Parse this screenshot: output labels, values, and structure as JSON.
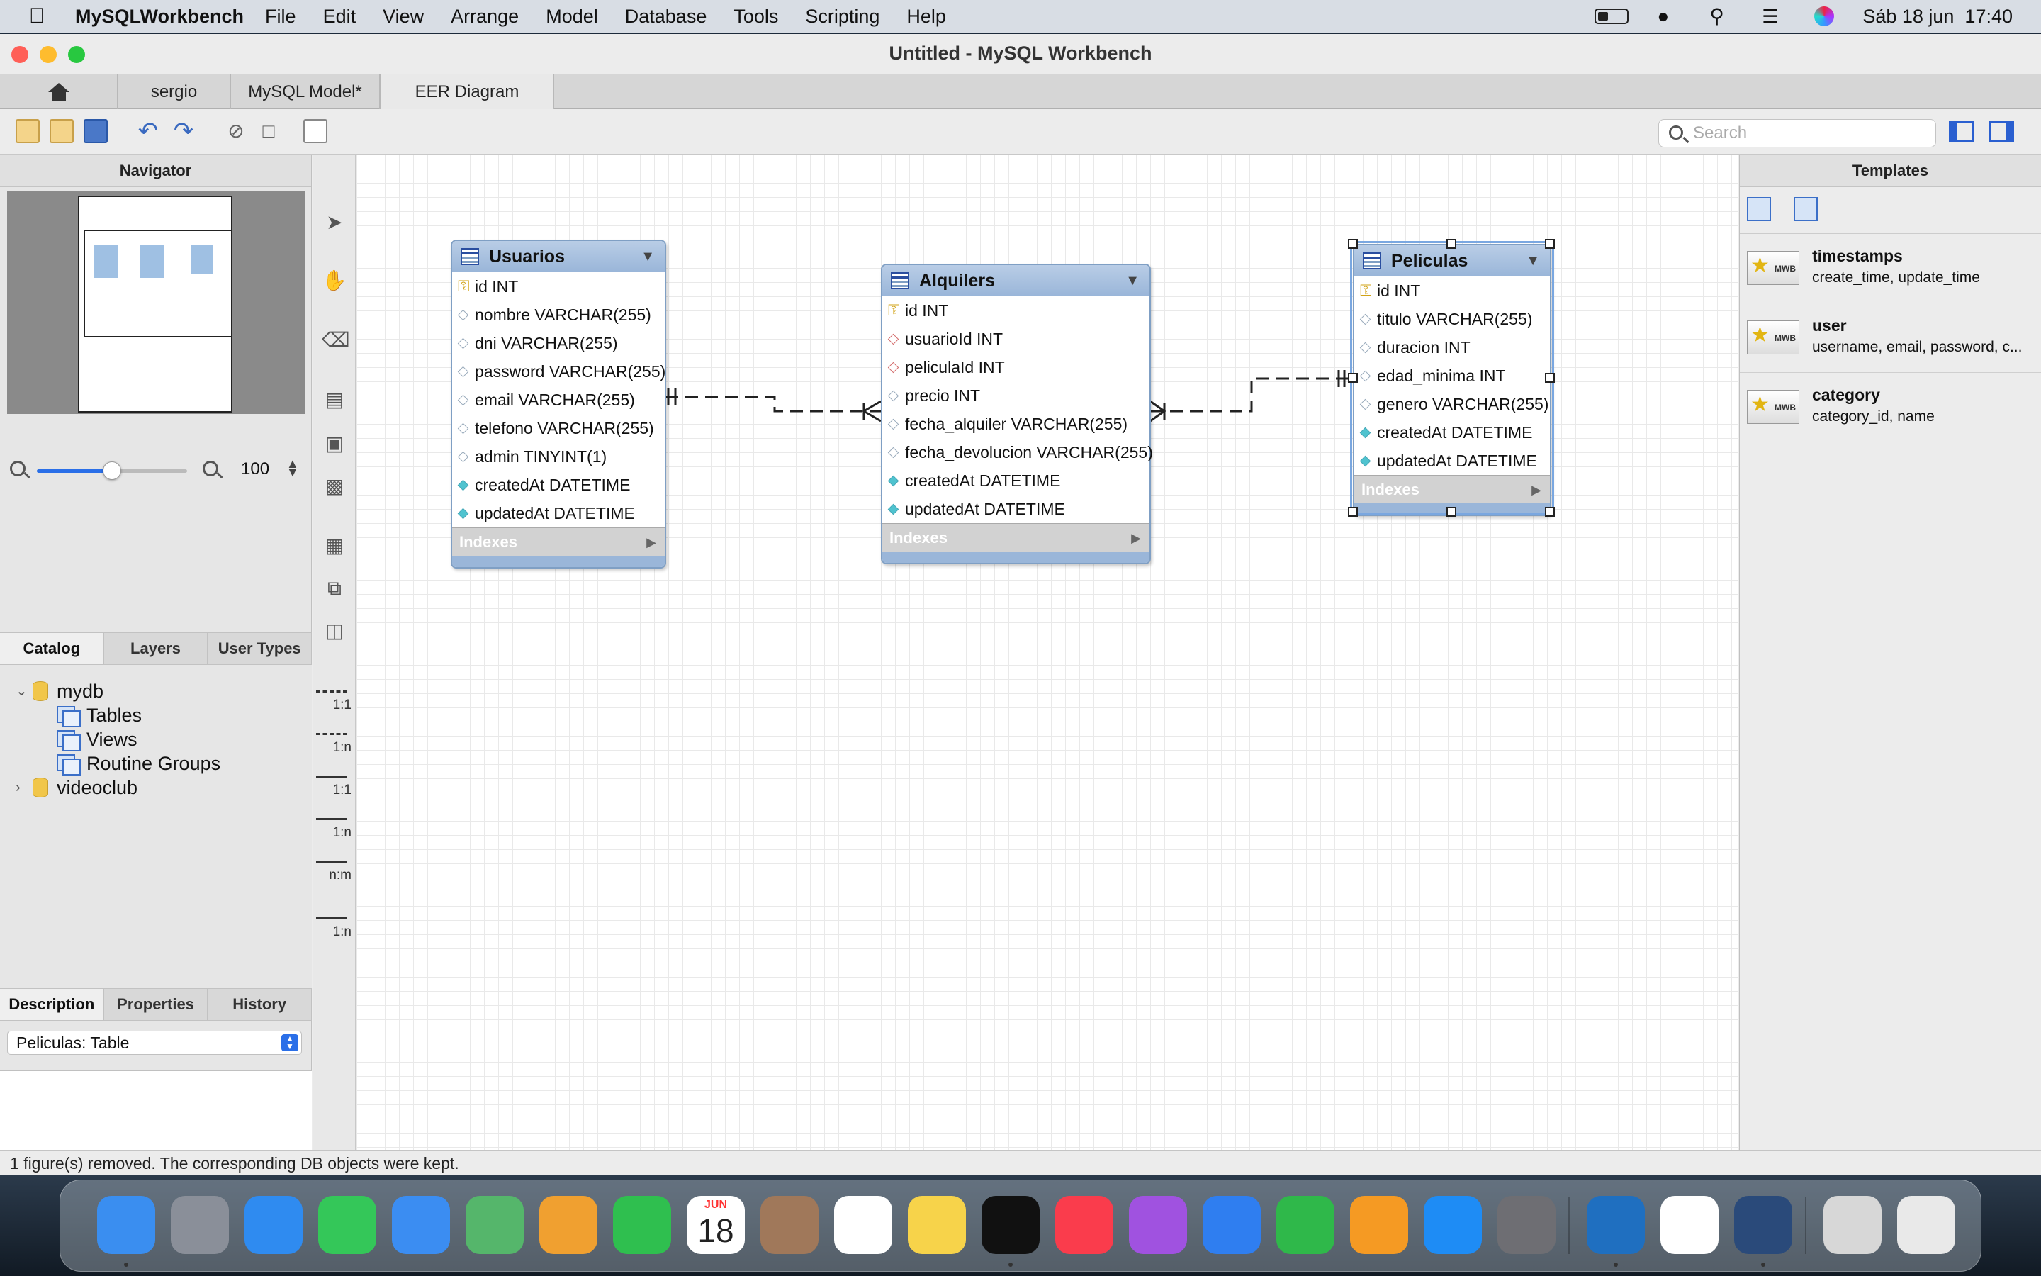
{
  "menubar": {
    "app_name": "MySQLWorkbench",
    "items": [
      "File",
      "Edit",
      "View",
      "Arrange",
      "Model",
      "Database",
      "Tools",
      "Scripting",
      "Help"
    ],
    "clock": "Sáb 18 jun  17:40"
  },
  "window": {
    "title": "Untitled - MySQL Workbench"
  },
  "tabs": [
    "sergio",
    "MySQL Model*",
    "EER Diagram"
  ],
  "toolbar": {
    "search_placeholder": "Search"
  },
  "navigator": {
    "title": "Navigator",
    "zoom_value": "100",
    "zoom_fraction": 0.5
  },
  "catalog": {
    "tabs": [
      "Catalog",
      "Layers",
      "User Types"
    ],
    "tree": [
      {
        "label": "mydb",
        "expanded": true
      },
      {
        "label": "Tables"
      },
      {
        "label": "Views"
      },
      {
        "label": "Routine Groups"
      },
      {
        "label": "videoclub",
        "expanded": false
      }
    ]
  },
  "description": {
    "tabs": [
      "Description",
      "Properties",
      "History"
    ],
    "selected": "Peliculas: Table"
  },
  "tools": {
    "relationships": [
      "1:1",
      "1:n",
      "1:1",
      "1:n",
      "n:m",
      "1:n"
    ]
  },
  "entities": [
    {
      "name": "Usuarios",
      "columns": [
        {
          "text": "id INT",
          "kind": "key"
        },
        {
          "text": "nombre VARCHAR(255)",
          "kind": "pl"
        },
        {
          "text": "dni VARCHAR(255)",
          "kind": "pl"
        },
        {
          "text": "password VARCHAR(255)",
          "kind": "pl"
        },
        {
          "text": "email VARCHAR(255)",
          "kind": "pl"
        },
        {
          "text": "telefono VARCHAR(255)",
          "kind": "pl"
        },
        {
          "text": "admin TINYINT(1)",
          "kind": "pl"
        },
        {
          "text": "createdAt DATETIME",
          "kind": "nn"
        },
        {
          "text": "updatedAt DATETIME",
          "kind": "nn"
        }
      ],
      "indexes_label": "Indexes"
    },
    {
      "name": "Alquilers",
      "columns": [
        {
          "text": "id INT",
          "kind": "key"
        },
        {
          "text": "usuarioId INT",
          "kind": "fk"
        },
        {
          "text": "peliculaId INT",
          "kind": "fk"
        },
        {
          "text": "precio INT",
          "kind": "pl"
        },
        {
          "text": "fecha_alquiler VARCHAR(255)",
          "kind": "pl"
        },
        {
          "text": "fecha_devolucion VARCHAR(255)",
          "kind": "pl"
        },
        {
          "text": "createdAt DATETIME",
          "kind": "nn"
        },
        {
          "text": "updatedAt DATETIME",
          "kind": "nn"
        }
      ],
      "indexes_label": "Indexes"
    },
    {
      "name": "Peliculas",
      "columns": [
        {
          "text": "id INT",
          "kind": "key"
        },
        {
          "text": "titulo VARCHAR(255)",
          "kind": "pl"
        },
        {
          "text": "duracion INT",
          "kind": "pl"
        },
        {
          "text": "edad_minima INT",
          "kind": "pl"
        },
        {
          "text": "genero VARCHAR(255)",
          "kind": "pl"
        },
        {
          "text": "createdAt DATETIME",
          "kind": "nn"
        },
        {
          "text": "updatedAt DATETIME",
          "kind": "nn"
        }
      ],
      "indexes_label": "Indexes",
      "selected": true
    }
  ],
  "templates": {
    "title": "Templates",
    "items": [
      {
        "name": "timestamps",
        "desc": "create_time, update_time"
      },
      {
        "name": "user",
        "desc": "username, email, password, c..."
      },
      {
        "name": "category",
        "desc": "category_id, name"
      }
    ]
  },
  "status": "1 figure(s) removed. The corresponding DB objects were kept.",
  "dock": {
    "calendar_month": "JUN",
    "calendar_day": "18",
    "apps": [
      "finder-icon",
      "launchpad-icon",
      "safari-icon",
      "messages-icon",
      "mail-icon",
      "maps-icon",
      "photos-icon",
      "facetime-icon",
      "calendar-icon",
      "contacts-icon",
      "reminders-icon",
      "notes-icon",
      "appletv-icon",
      "music-icon",
      "podcasts-icon",
      "keynote-icon",
      "numbers-icon",
      "pages-icon",
      "appstore-icon",
      "systemprefs-icon",
      "vscode-icon",
      "slack-icon",
      "mysqlworkbench-icon",
      "downloads-icon",
      "trash-icon"
    ]
  }
}
